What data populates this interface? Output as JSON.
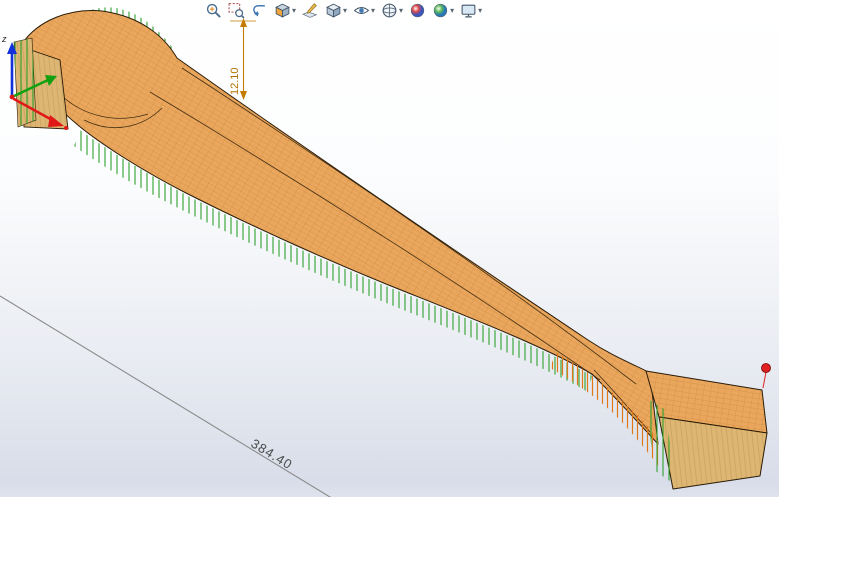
{
  "toolbar": {
    "caret": "▾",
    "icons": [
      {
        "name": "zoom-to-fit-icon",
        "dropdown": false
      },
      {
        "name": "zoom-to-area-icon",
        "dropdown": false
      },
      {
        "name": "previous-view-icon",
        "dropdown": false
      },
      {
        "name": "section-view-icon",
        "dropdown": true
      },
      {
        "name": "annotation-views-icon",
        "dropdown": false
      },
      {
        "name": "display-style-icon",
        "dropdown": true
      },
      {
        "name": "hide-show-items-icon",
        "dropdown": true
      },
      {
        "name": "view-orientation-icon",
        "dropdown": true
      },
      {
        "name": "edit-appearance-icon",
        "dropdown": false
      },
      {
        "name": "apply-scene-icon",
        "dropdown": true
      },
      {
        "name": "view-settings-icon",
        "dropdown": true
      }
    ]
  },
  "viewport": {
    "dimensions": {
      "length": {
        "value": "384.40"
      },
      "height": {
        "value": "12.10"
      }
    },
    "triad": {
      "z_label": "z"
    }
  },
  "colors": {
    "surface": "#e9a65c",
    "mesh_line": "#a4641a",
    "wood": "#ddb674",
    "wood_grain": "#b98a3e",
    "comb_green": "#2da02c",
    "comb_orange": "#e07818",
    "edge": "#2a1c08",
    "dimension_gray": "#6f6f6f",
    "dimension_orange": "#c27b00",
    "axis_red": "#e01818",
    "axis_green": "#10a010",
    "axis_blue": "#1430d8",
    "vertex_red": "#e02020"
  }
}
